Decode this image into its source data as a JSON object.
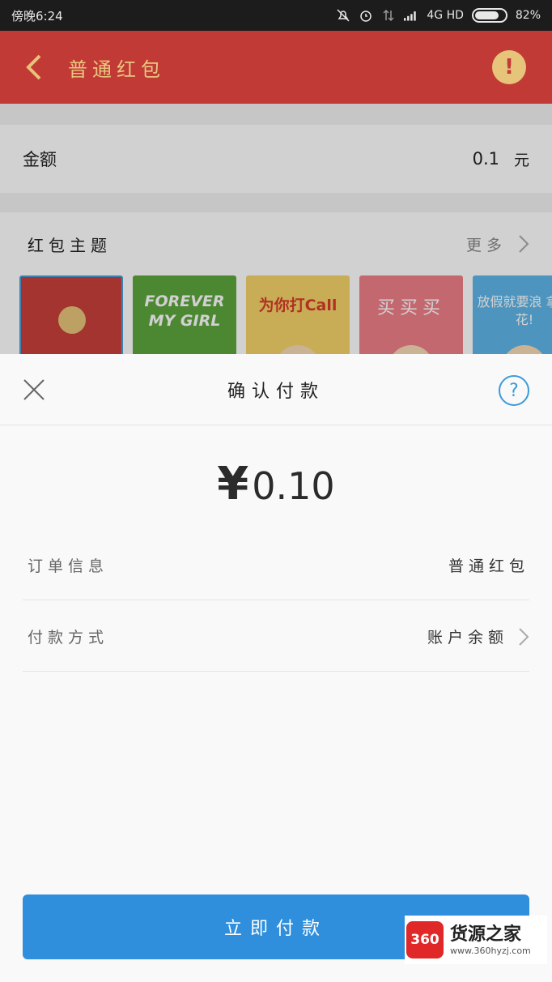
{
  "status_bar": {
    "carrier": "傍晚6:24",
    "network": "4G HD",
    "battery": "82%",
    "battery_level": 0.82
  },
  "header": {
    "title": "普通红包"
  },
  "amount_row": {
    "label": "金额",
    "value": "0.1",
    "unit": "元"
  },
  "theme": {
    "label": "红包主题",
    "more": "更多",
    "cards": [
      {
        "text": ""
      },
      {
        "text": "FOREVER MY GIRL"
      },
      {
        "text": "为你打Call"
      },
      {
        "text": "买买买"
      },
      {
        "text": "放假就要浪 拿去花!"
      }
    ]
  },
  "sheet": {
    "title": "确认付款",
    "currency_symbol": "¥",
    "amount": "0.10",
    "order_label": "订单信息",
    "order_value": "普通红包",
    "method_label": "付款方式",
    "method_value": "账户余额",
    "pay_button": "立即付款"
  },
  "watermark": {
    "logo": "360",
    "name": "货源之家",
    "url": "www.360hyzj.com"
  },
  "colors": {
    "header_red": "#c23a36",
    "gold": "#e6c47a",
    "button_blue": "#2f8fdc"
  }
}
